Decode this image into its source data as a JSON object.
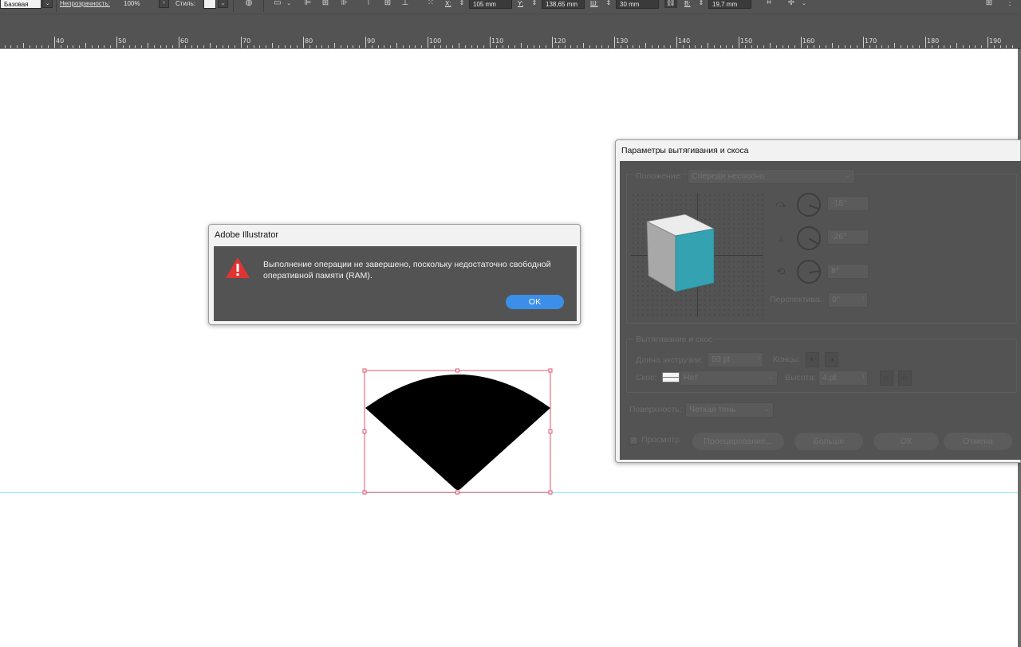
{
  "control_bar": {
    "style_preset": "Базовая",
    "opacity_label": "Непрозрачность:",
    "opacity_value": "100%",
    "style_label": "Стиль:",
    "x_label": "X:",
    "x_value": "105 mm",
    "y_label": "Y:",
    "y_value": "138,65 mm",
    "w_label": "Ш:",
    "w_value": "30 mm",
    "h_label": "В:",
    "h_value": "19,7 mm"
  },
  "ruler": {
    "labels": [
      "40",
      "50",
      "60",
      "70",
      "80",
      "90",
      "100",
      "110",
      "120",
      "130",
      "140",
      "150",
      "160",
      "170",
      "180",
      "190"
    ]
  },
  "alert": {
    "title": "Adobe Illustrator",
    "message": "Выполнение операции не завершено, поскольку недостаточно свободной оперативной памяти (RAM).",
    "ok_label": "OK"
  },
  "extrude_dialog": {
    "title": "Параметры вытягивания и скоса",
    "position_label": "Положение:",
    "position_value": "Спереди несоосно",
    "rotation_x": "-18°",
    "rotation_y": "-26°",
    "rotation_z": "8°",
    "perspective_label": "Перспектива:",
    "perspective_value": "0°",
    "extrude_section": "Вытягивание и скос",
    "extrude_depth_label": "Длина экструзии:",
    "extrude_depth_value": "50 pt",
    "cap_label": "Концы:",
    "bevel_label": "Скос:",
    "bevel_value": "Нет",
    "height_label": "Высота:",
    "height_value": "4 pt",
    "surface_label": "Поверхность:",
    "surface_value": "Четкая тень",
    "preview_label": "Просмотр",
    "map_art_label": "Проецирование...",
    "more_options_label": "Больше",
    "ok_label": "ОК",
    "cancel_label": "Отмена",
    "cube_front_color": "#35a2b2"
  }
}
